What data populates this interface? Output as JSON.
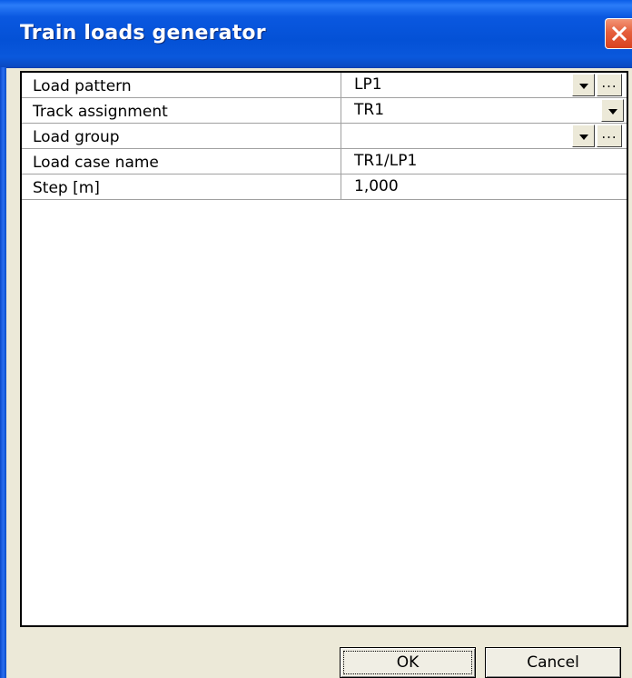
{
  "window": {
    "title": "Train loads generator"
  },
  "grid": {
    "rows": [
      {
        "label": "Load pattern",
        "value": "LP1",
        "has_dropdown": true,
        "has_browse": true
      },
      {
        "label": "Track assignment",
        "value": "TR1",
        "has_dropdown": true,
        "has_browse": false
      },
      {
        "label": "Load group",
        "value": "",
        "has_dropdown": true,
        "has_browse": true
      },
      {
        "label": "Load case name",
        "value": "TR1/LP1",
        "has_dropdown": false,
        "has_browse": false
      },
      {
        "label": "Step [m]",
        "value": "1,000",
        "has_dropdown": false,
        "has_browse": false
      }
    ],
    "browse_label": "..."
  },
  "buttons": {
    "ok": "OK",
    "cancel": "Cancel"
  },
  "icons": {
    "close": "close-icon",
    "dropdown": "chevron-down-icon"
  }
}
